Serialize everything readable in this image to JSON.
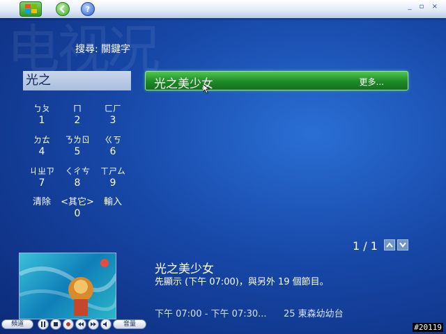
{
  "header": {
    "search_label": "搜尋: 關鍵字",
    "watermark": "电视况",
    "window_controls": "_ ▫ ×"
  },
  "search": {
    "current_value": "光之"
  },
  "keypad": {
    "keys": [
      {
        "zhuyin": "ㄅㄆ",
        "num": "1"
      },
      {
        "zhuyin": "ㄇ",
        "num": "2"
      },
      {
        "zhuyin": "ㄈㄏ",
        "num": "3"
      },
      {
        "zhuyin": "ㄉㄊ",
        "num": "4"
      },
      {
        "zhuyin": "ㄋㄌㄖ",
        "num": "5"
      },
      {
        "zhuyin": "ㄍㄎ",
        "num": "6"
      },
      {
        "zhuyin": "ㄐㄓㄗ",
        "num": "7"
      },
      {
        "zhuyin": "ㄑㄔㄘ",
        "num": "8"
      },
      {
        "zhuyin": "ㄒㄕㄙ",
        "num": "9"
      },
      {
        "zhuyin": "清除",
        "num": ""
      },
      {
        "zhuyin": "<其它>",
        "num": "0"
      },
      {
        "zhuyin": "輸入",
        "num": ""
      }
    ]
  },
  "results": {
    "items": [
      {
        "title": "光之美少女",
        "more_label": "更多..."
      }
    ],
    "pager": "1 / 1"
  },
  "detail": {
    "title": "光之美少女",
    "description": "先顯示 (下午 07:00)，與另外 19 個節目。",
    "time_range": "下午 07:00 - 下午 07:30...",
    "channel": "25 東森幼幼台"
  },
  "transport": {
    "channel_label": "頻道",
    "volume_label": "音量"
  },
  "corner_id": "#20119",
  "colors": {
    "accent_green": "#1d8a26",
    "background_blue": "#1748a8"
  }
}
